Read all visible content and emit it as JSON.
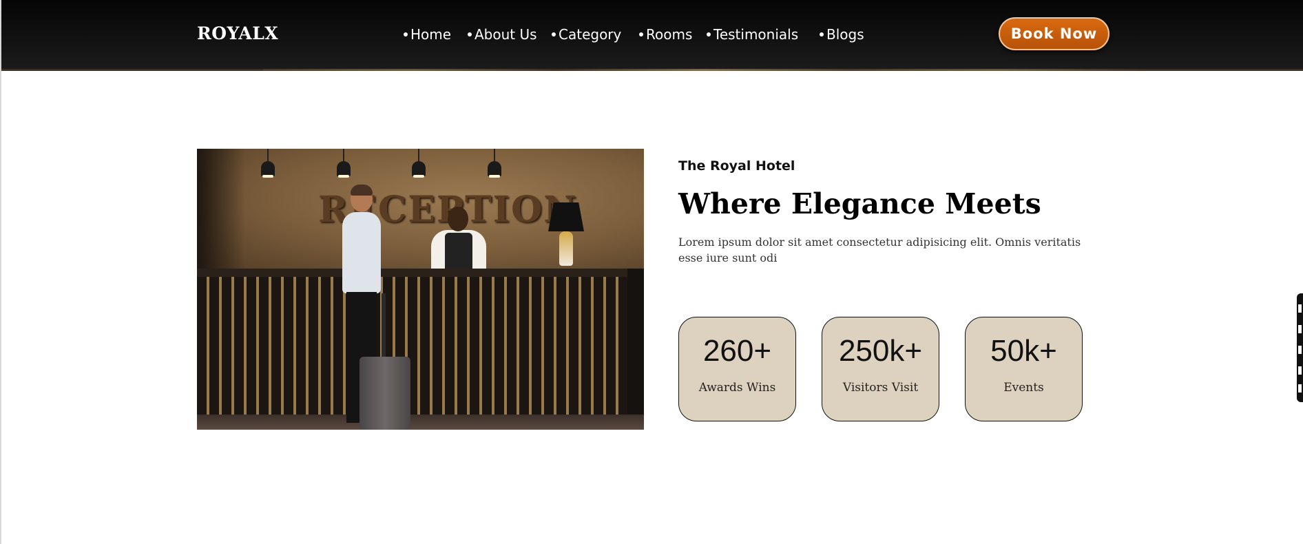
{
  "header": {
    "brand": "ROYALX",
    "nav": [
      {
        "label": "Home"
      },
      {
        "label": "About Us"
      },
      {
        "label": "Category"
      },
      {
        "label": "Rooms"
      },
      {
        "label": "Testimonials"
      },
      {
        "label": "Blogs"
      }
    ],
    "cta": "Book Now"
  },
  "hero_image": {
    "sign_text": "RECEPTION"
  },
  "about": {
    "eyebrow": "The Royal Hotel",
    "title": "Where Elegance Meets",
    "description": "Lorem ipsum dolor sit amet consectetur adipisicing elit. Omnis veritatis esse iure sunt odi"
  },
  "stats": [
    {
      "value": "260+",
      "label": "Awards Wins"
    },
    {
      "value": "250k+",
      "label": "Visitors Visit"
    },
    {
      "value": "50k+",
      "label": "Events"
    }
  ],
  "colors": {
    "accent": "#c8600c",
    "stat_bg": "#ddd1c0",
    "header_bg": "#0e0e0e"
  }
}
